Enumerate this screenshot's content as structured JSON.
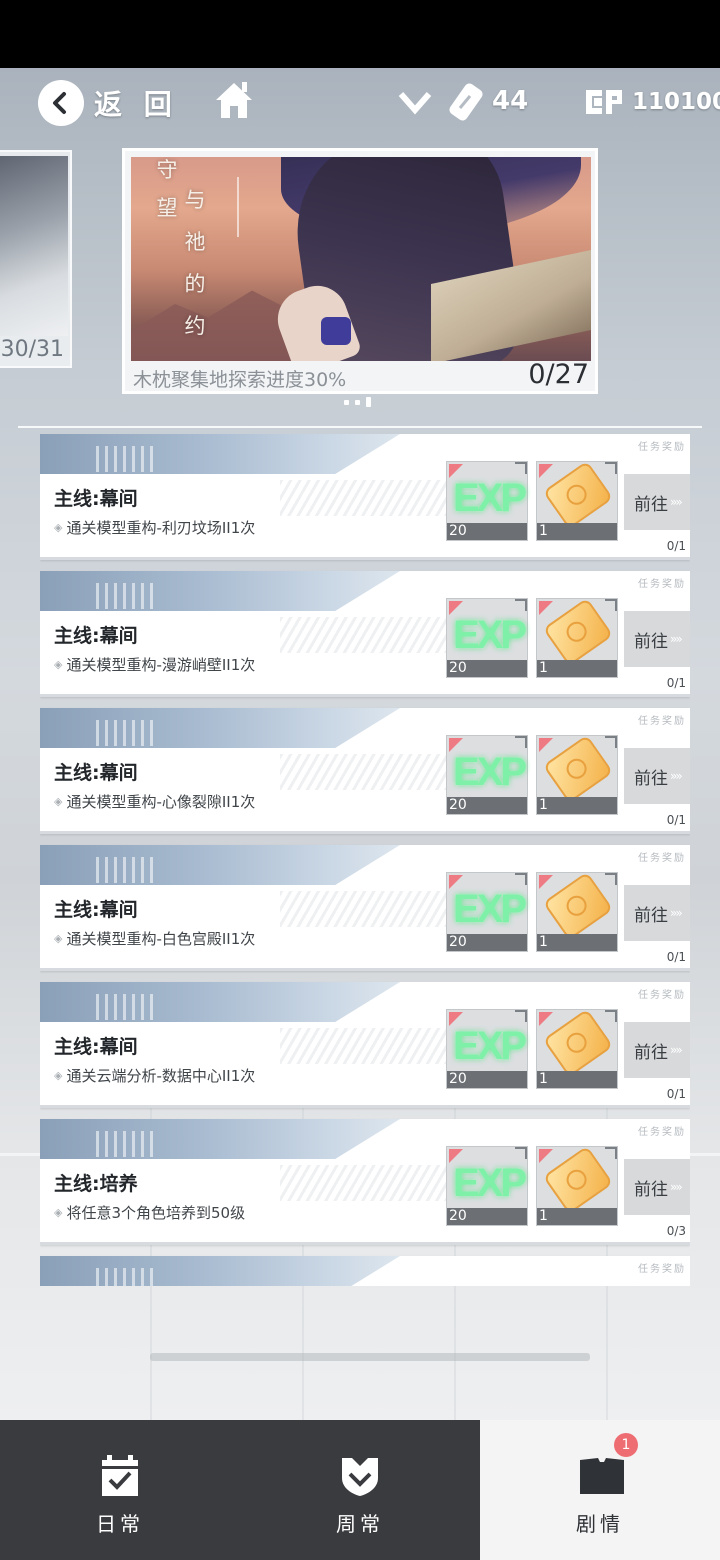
{
  "nav": {
    "back_label": "返 回",
    "resource_count": "44",
    "cp_value": "110100"
  },
  "carousel": {
    "side_card": {
      "count": "30/31"
    },
    "main_card": {
      "art_text": [
        "守",
        "望",
        "与",
        "祂",
        "的",
        "约"
      ],
      "caption": "木枕聚集地探索进度30%",
      "count": "0/27"
    }
  },
  "quests": [
    {
      "title": "主线:幕间",
      "desc": "通关模型重构-利刃坟场II1次",
      "progress": "0/1",
      "rewards": [
        {
          "icon": "exp-icon",
          "label": "EXP",
          "count": "20"
        },
        {
          "icon": "ticket-icon",
          "count": "1"
        }
      ],
      "go_label": "前往",
      "reward_tag": "任务奖励"
    },
    {
      "title": "主线:幕间",
      "desc": "通关模型重构-漫游峭壁II1次",
      "progress": "0/1",
      "rewards": [
        {
          "icon": "exp-icon",
          "label": "EXP",
          "count": "20"
        },
        {
          "icon": "ticket-icon",
          "count": "1"
        }
      ],
      "go_label": "前往",
      "reward_tag": "任务奖励"
    },
    {
      "title": "主线:幕间",
      "desc": "通关模型重构-心像裂隙II1次",
      "progress": "0/1",
      "rewards": [
        {
          "icon": "exp-icon",
          "label": "EXP",
          "count": "20"
        },
        {
          "icon": "ticket-icon",
          "count": "1"
        }
      ],
      "go_label": "前往",
      "reward_tag": "任务奖励"
    },
    {
      "title": "主线:幕间",
      "desc": "通关模型重构-白色宫殿II1次",
      "progress": "0/1",
      "rewards": [
        {
          "icon": "exp-icon",
          "label": "EXP",
          "count": "20"
        },
        {
          "icon": "ticket-icon",
          "count": "1"
        }
      ],
      "go_label": "前往",
      "reward_tag": "任务奖励"
    },
    {
      "title": "主线:幕间",
      "desc": "通关云端分析-数据中心II1次",
      "progress": "0/1",
      "rewards": [
        {
          "icon": "exp-icon",
          "label": "EXP",
          "count": "20"
        },
        {
          "icon": "ticket-icon",
          "count": "1"
        }
      ],
      "go_label": "前往",
      "reward_tag": "任务奖励"
    },
    {
      "title": "主线:培养",
      "desc": "将任意3个角色培养到50级",
      "progress": "0/3",
      "rewards": [
        {
          "icon": "exp-icon",
          "label": "EXP",
          "count": "20"
        },
        {
          "icon": "ticket-icon",
          "count": "1"
        }
      ],
      "go_label": "前往",
      "reward_tag": "任务奖励"
    }
  ],
  "partial_quest": {
    "reward_tag": "任务奖励"
  },
  "tabs": [
    {
      "label": "日常",
      "icon": "calendar-check-icon",
      "active": false
    },
    {
      "label": "周常",
      "icon": "shield-emblem-icon",
      "active": false
    },
    {
      "label": "剧情",
      "icon": "book-icon",
      "active": true,
      "badge": "1"
    }
  ]
}
